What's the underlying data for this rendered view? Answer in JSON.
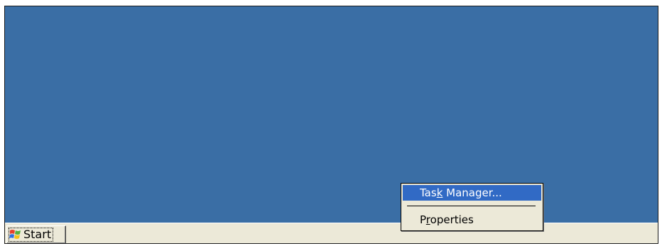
{
  "desktop": {
    "background_color": "#3a6ea5"
  },
  "taskbar": {
    "start_button": {
      "label": "Start",
      "icon": "windows-flag-icon"
    }
  },
  "context_menu": {
    "items": [
      {
        "pre": "Tas",
        "accel": "k",
        "post": " Manager...",
        "highlighted": true
      },
      {
        "pre": "P",
        "accel": "r",
        "post": "operties",
        "highlighted": false
      }
    ]
  },
  "colors": {
    "highlight": "#316ac5",
    "menu_background": "#ece9d8",
    "taskbar": "#ece9d8"
  }
}
